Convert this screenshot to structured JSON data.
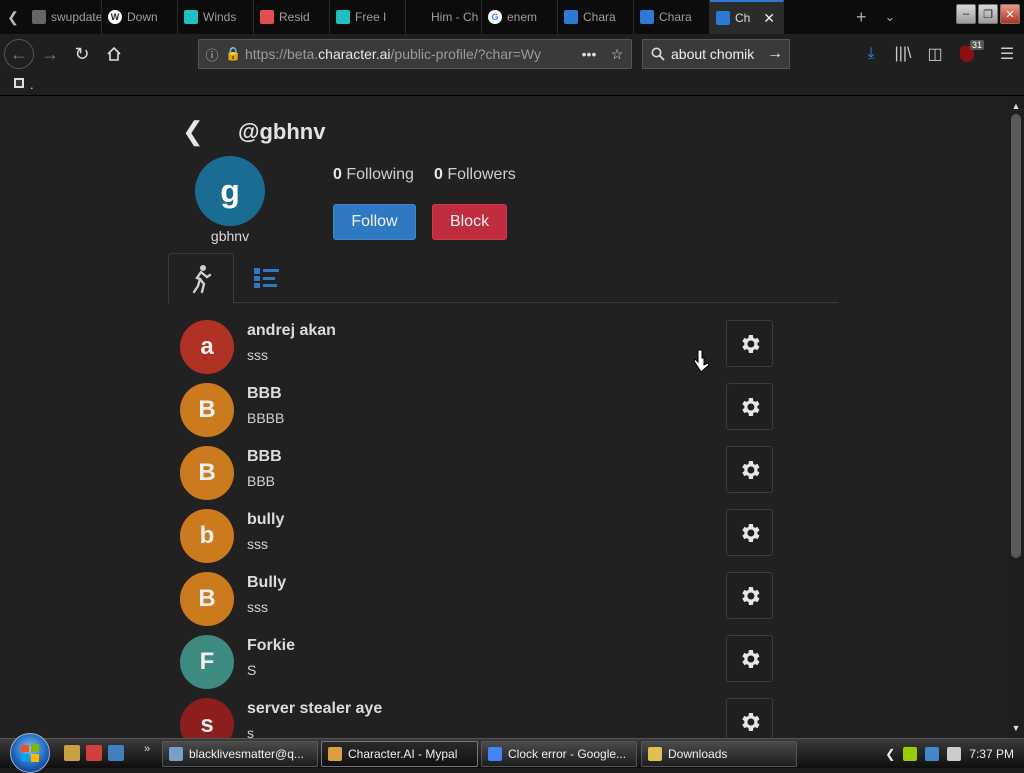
{
  "browser": {
    "tabs": [
      {
        "label": "swupdate",
        "icon": "page-icon",
        "color": "#666666"
      },
      {
        "label": "Down",
        "icon": "wordpress-icon",
        "color": "#ffffff"
      },
      {
        "label": "Winds",
        "icon": "cube-icon",
        "color": "#20c0c0"
      },
      {
        "label": "Resid",
        "icon": "rainbow-icon",
        "color": "#e05050"
      },
      {
        "label": "Free I",
        "icon": "cube-icon",
        "color": "#20c0c0"
      },
      {
        "label": "Him - Ch",
        "icon": "none",
        "color": "#333333"
      },
      {
        "label": "enem",
        "icon": "google-icon",
        "color": "#4285f4"
      },
      {
        "label": "Chara",
        "icon": "character-ai-icon",
        "color": "#2c7ad6"
      },
      {
        "label": "Chara",
        "icon": "character-ai-icon",
        "color": "#2c7ad6"
      },
      {
        "label": "Ch",
        "icon": "character-ai-icon",
        "color": "#2c7ad6",
        "active": true
      }
    ],
    "url_prefix": "https://beta.",
    "url_domain": "character.ai",
    "url_suffix": "/public-profile/?char=Wy",
    "search_text": "about chomik",
    "notification_count": "31",
    "bookmark_label": "."
  },
  "profile": {
    "handle": "@gbhnv",
    "avatar_letter": "g",
    "avatar_color": "#1b6c93",
    "name": "gbhnv",
    "following_count": "0",
    "following_label": "Following",
    "followers_count": "0",
    "followers_label": "Followers",
    "follow_label": "Follow",
    "block_label": "Block"
  },
  "characters": [
    {
      "letter": "a",
      "name": "andrej akan",
      "desc": "sss",
      "color": "#b03224"
    },
    {
      "letter": "B",
      "name": "BBB",
      "desc": "BBBB",
      "color": "#cc7a1e"
    },
    {
      "letter": "B",
      "name": "BBB",
      "desc": "BBB",
      "color": "#cc7a1e"
    },
    {
      "letter": "b",
      "name": "bully",
      "desc": "sss",
      "color": "#cc7a1e"
    },
    {
      "letter": "B",
      "name": "Bully",
      "desc": "sss",
      "color": "#cc7a1e"
    },
    {
      "letter": "F",
      "name": "Forkie",
      "desc": "S",
      "color": "#3d8a80"
    },
    {
      "letter": "s",
      "name": "server stealer aye",
      "desc": "s",
      "color": "#8c1e1e"
    }
  ],
  "taskbar": {
    "tasks": [
      {
        "label": "blacklivesmatter@q...",
        "color": "#7aa0c8"
      },
      {
        "label": "Character.AI - Mypal",
        "color": "#d8a040",
        "active": true
      },
      {
        "label": "Clock error - Google...",
        "color": "#4285f4"
      },
      {
        "label": "Downloads",
        "color": "#e0c050"
      }
    ],
    "time": "7:37 PM"
  }
}
